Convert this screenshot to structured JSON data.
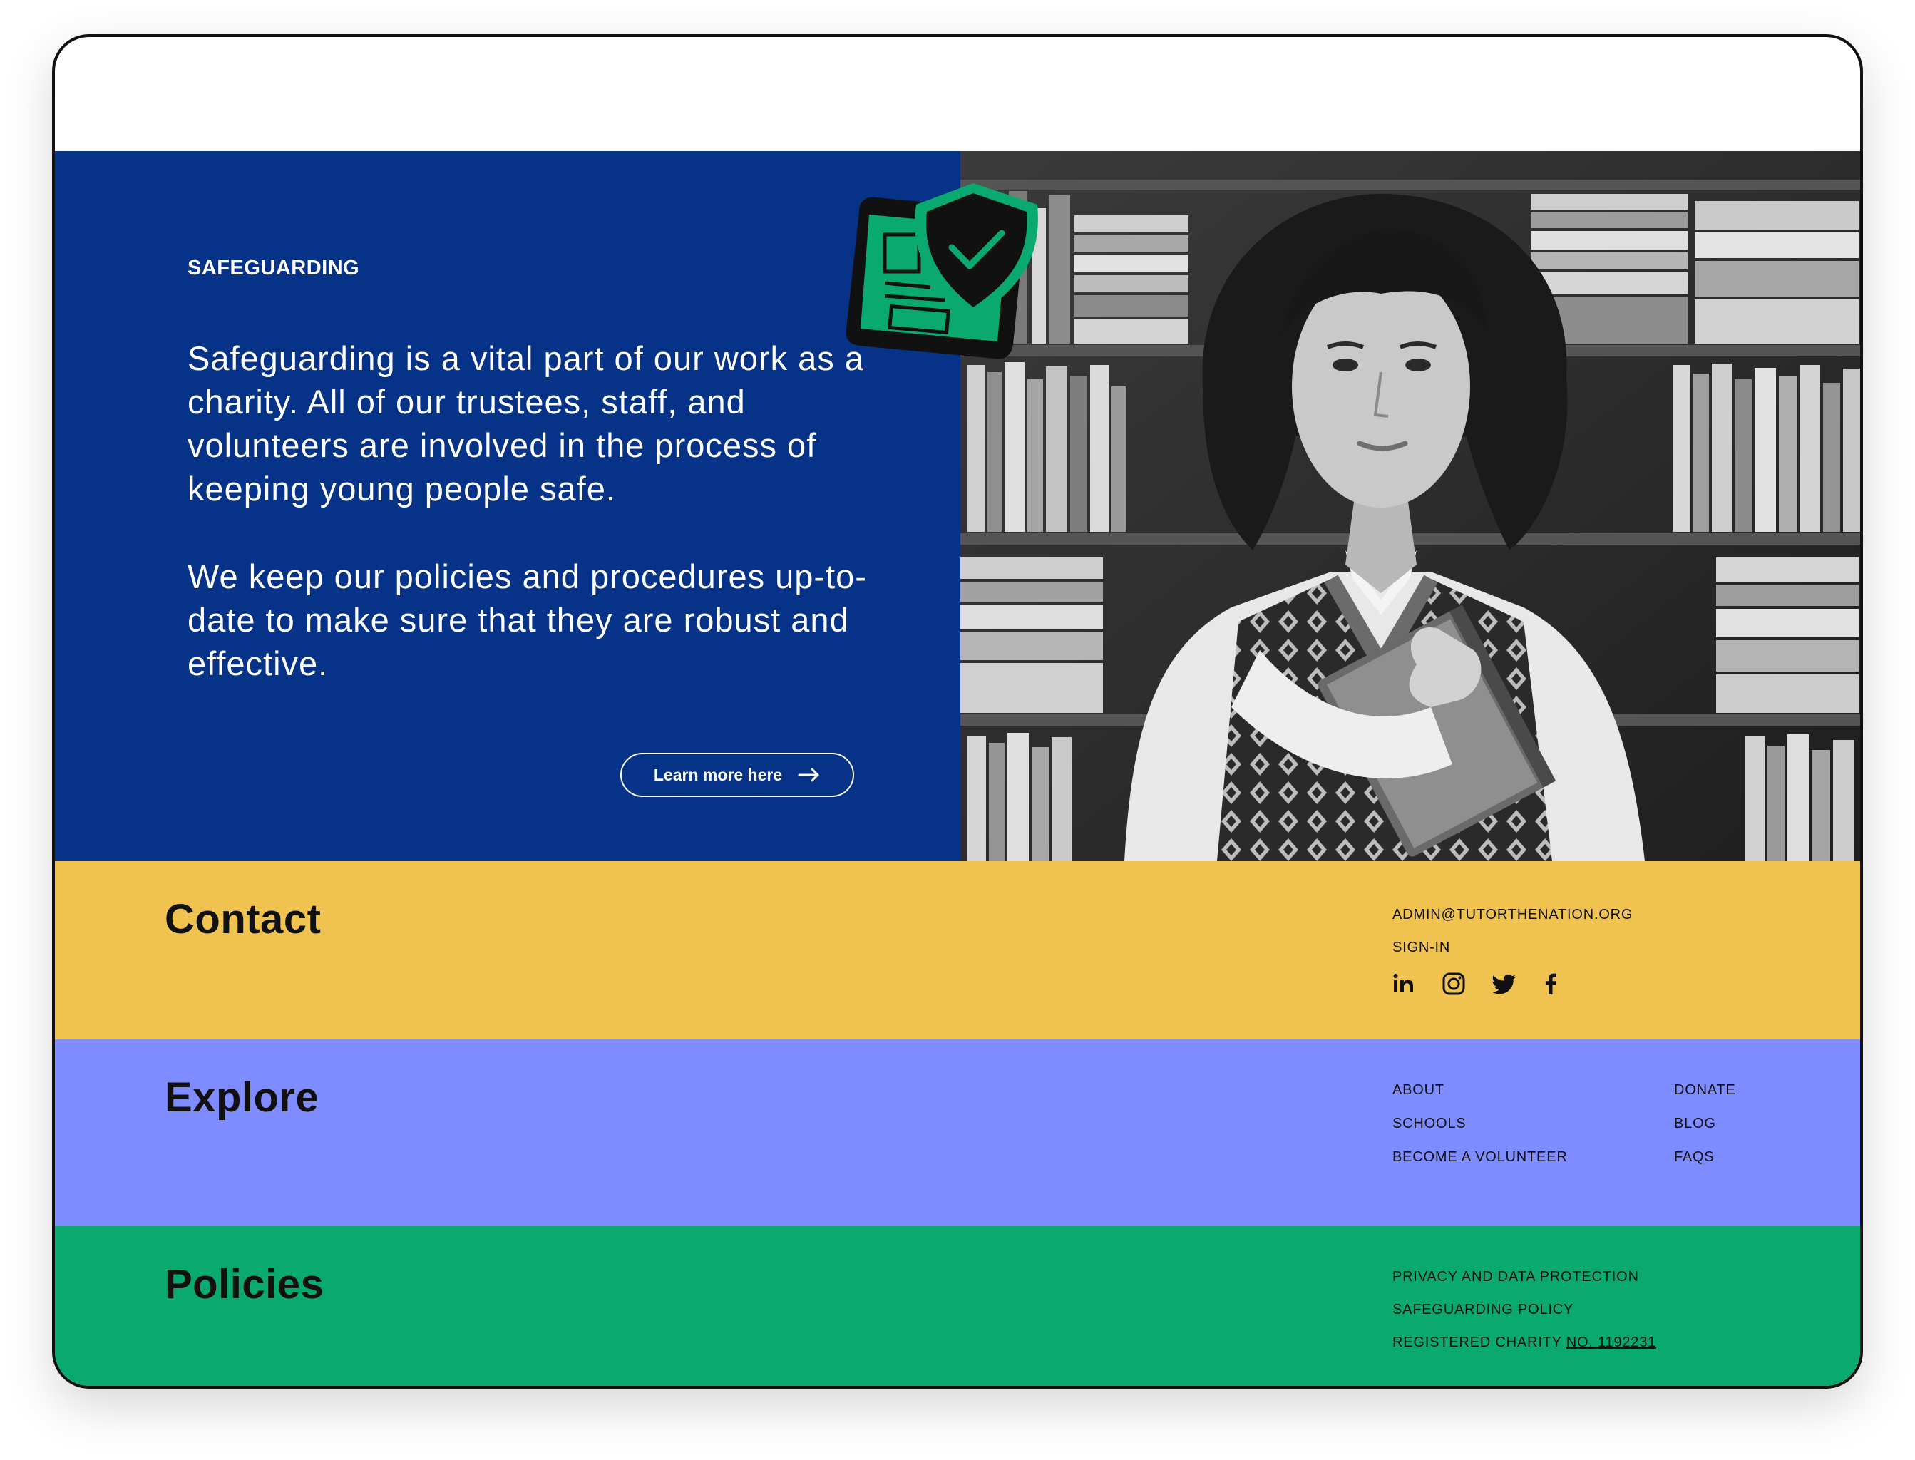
{
  "hero": {
    "eyebrow": "SAFEGUARDING",
    "paragraph_1": "Safeguarding is a vital part of our work as a charity. All of our trustees, staff, and volunteers are involved in the process of keeping young people safe.",
    "paragraph_2": "We keep our policies and procedures up-to-date to make sure that they are robust and effective.",
    "cta_label": "Learn more here",
    "colors": {
      "background": "#063387",
      "text": "#ffffff",
      "sticker_green": "#0aa96f",
      "shield": "#111111"
    }
  },
  "contact": {
    "title": "Contact",
    "email": "ADMIN@TUTORTHENATION.ORG",
    "sign_in": "SIGN-IN",
    "social_icons": [
      "linkedin-icon",
      "instagram-icon",
      "twitter-icon",
      "facebook-icon"
    ],
    "color": "#f0c351"
  },
  "explore": {
    "title": "Explore",
    "links_col1": [
      "ABOUT",
      "SCHOOLS",
      "BECOME A VOLUNTEER"
    ],
    "links_col2": [
      "DONATE",
      "BLOG",
      "FAQS"
    ],
    "color": "#7f8cff"
  },
  "policies": {
    "title": "Policies",
    "privacy": "PRIVACY AND DATA PROTECTION",
    "safeguarding_policy": "SAFEGUARDING POLICY",
    "charity_prefix": "REGISTERED CHARITY ",
    "charity_number": "NO. 1192231",
    "color": "#0aa96f"
  }
}
